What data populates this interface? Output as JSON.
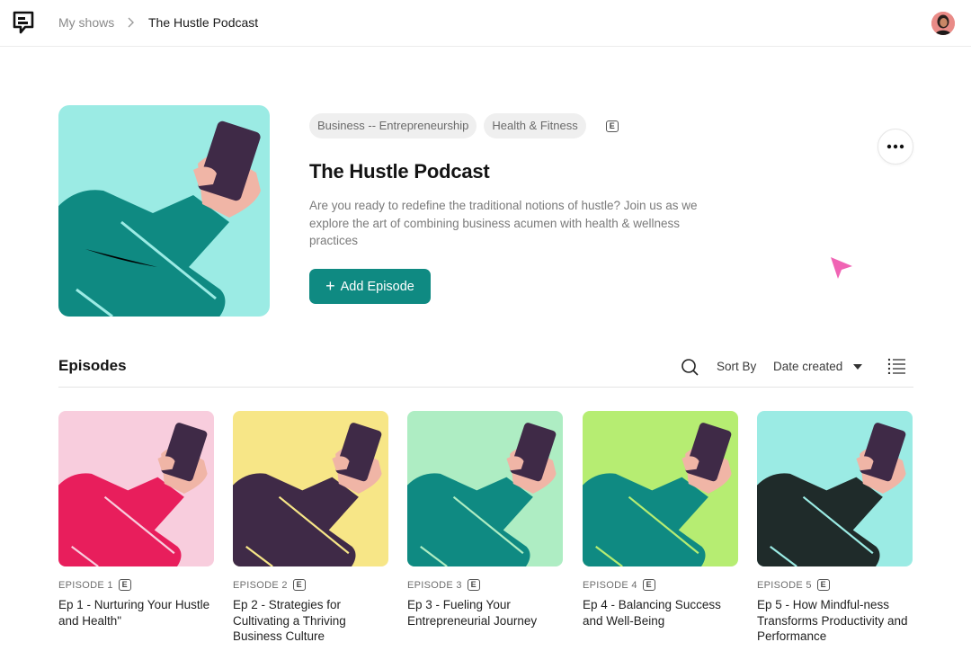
{
  "breadcrumb": {
    "root": "My shows",
    "current": "The Hustle Podcast"
  },
  "show": {
    "tags": [
      "Business -- Entrepreneurship",
      "Health & Fitness"
    ],
    "explicit_badge": "E",
    "title": "The Hustle Podcast",
    "description": "Are you ready to redefine the traditional notions of hustle? Join us as we explore the art of combining business acumen with health & wellness practices",
    "add_episode_label": "Add Episode",
    "cover_colors": {
      "background": "#9bebe4",
      "sleeve": "#0f8a82"
    }
  },
  "episodes_section": {
    "heading": "Episodes",
    "sort_label": "Sort By",
    "sort_value": "Date created"
  },
  "episodes": [
    {
      "number_label": "EPISODE 1",
      "explicit": "E",
      "title": "Ep 1 - Nurturing Your Hustle and Health\"",
      "bg": "#f8cddd",
      "sleeve": "#e81e5c",
      "stripe": "#f8cddd"
    },
    {
      "number_label": "EPISODE 2",
      "explicit": "E",
      "title": "Ep 2 - Strategies for Cultivating a Thriving Business Culture",
      "bg": "#f7e687",
      "sleeve": "#3f2a47",
      "stripe": "#f7e687"
    },
    {
      "number_label": "EPISODE 3",
      "explicit": "E",
      "title": "Ep 3 - Fueling Your Entrepreneurial Journey",
      "bg": "#aeedc3",
      "sleeve": "#0f8a82",
      "stripe": "#aeedc3"
    },
    {
      "number_label": "EPISODE 4",
      "explicit": "E",
      "title": "Ep 4 - Balancing Success and Well-Being",
      "bg": "#b6ed72",
      "sleeve": "#0f8a82",
      "stripe": "#b6ed72"
    },
    {
      "number_label": "EPISODE 5",
      "explicit": "E",
      "title": "Ep 5 - How Mindful-ness Transforms Productivity and Performance",
      "bg": "#9bebe4",
      "sleeve": "#1f2b2a",
      "stripe": "#9bebe4"
    }
  ],
  "colors": {
    "accent": "#0f8a82",
    "cursor": "#f064b4",
    "phone": "#3f2a47",
    "hand": "#f0b5a6"
  },
  "icons": {
    "logo": "chat-bubble-logo-icon",
    "more": "ellipsis-icon",
    "search": "search-icon",
    "view": "list-view-icon"
  }
}
